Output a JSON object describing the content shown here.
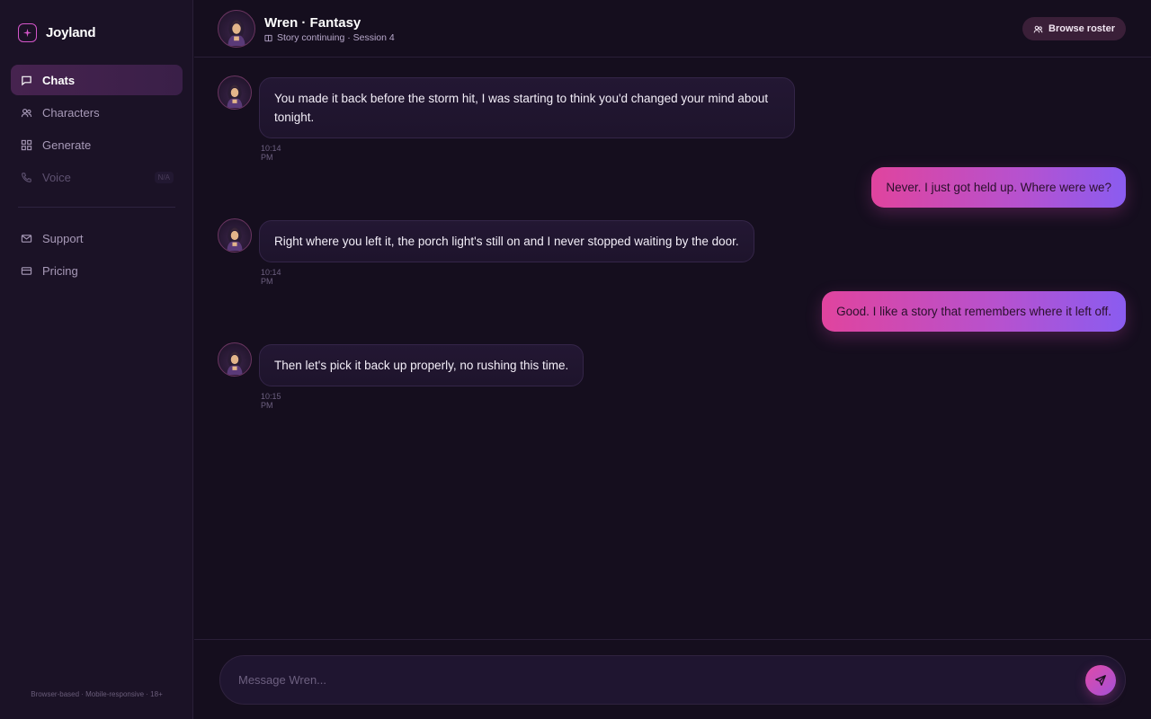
{
  "app": {
    "name": "Joyland"
  },
  "sidebar": {
    "items": [
      {
        "label": "Chats",
        "icon": "chat-icon",
        "active": true
      },
      {
        "label": "Characters",
        "icon": "users-icon"
      },
      {
        "label": "Generate",
        "icon": "grid-icon"
      },
      {
        "label": "Voice",
        "icon": "phone-icon",
        "disabled": true,
        "badge": "N/A"
      },
      {
        "label": "Support",
        "icon": "mail-icon"
      },
      {
        "label": "Pricing",
        "icon": "card-icon"
      }
    ],
    "footer": "Browser-based · Mobile-responsive · 18+"
  },
  "header": {
    "title": "Wren · Fantasy",
    "subtitle": "Story continuing · Session 4",
    "roster_button": "Browse roster"
  },
  "messages": [
    {
      "from": "ai",
      "text": "You made it back before the storm hit, I was starting to think you'd changed your mind about tonight.",
      "time": "10:14 PM"
    },
    {
      "from": "user",
      "text": "Never. I just got held up. Where were we?"
    },
    {
      "from": "ai",
      "text": "Right where you left it, the porch light's still on and I never stopped waiting by the door.",
      "time": "10:14 PM"
    },
    {
      "from": "user",
      "text": "Good. I like a story that remembers where it left off."
    },
    {
      "from": "ai",
      "text": "Then let's pick it back up properly, no rushing this time.",
      "time": "10:15 PM"
    }
  ],
  "composer": {
    "placeholder": "Message Wren..."
  },
  "colors": {
    "background": "#150e1e",
    "sidebar": "#1b1226",
    "accent_pink": "#e0449e",
    "accent_purple": "#8a5cf0",
    "ai_bubble": "#221732"
  }
}
